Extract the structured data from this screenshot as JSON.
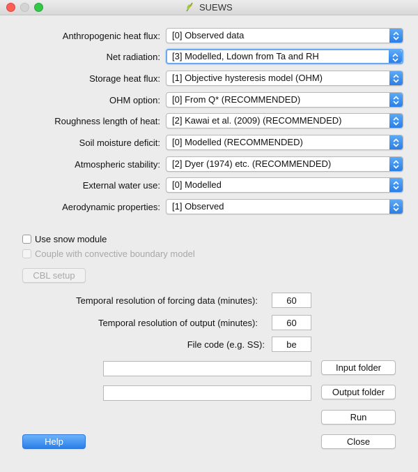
{
  "window": {
    "title": "SUEWS"
  },
  "options": [
    {
      "label": "Anthropogenic heat flux:",
      "value": "[0] Observed data"
    },
    {
      "label": "Net radiation:",
      "value": "[3] Modelled, Ldown from Ta and RH"
    },
    {
      "label": "Storage heat flux:",
      "value": "[1] Objective hysteresis model (OHM)"
    },
    {
      "label": "OHM option:",
      "value": "[0] From Q* (RECOMMENDED)"
    },
    {
      "label": "Roughness length of heat:",
      "value": "[2] Kawai et al. (2009) (RECOMMENDED)"
    },
    {
      "label": "Soil moisture deficit:",
      "value": "[0] Modelled (RECOMMENDED)"
    },
    {
      "label": "Atmospheric stability:",
      "value": "[2] Dyer (1974) etc. (RECOMMENDED)"
    },
    {
      "label": "External water use:",
      "value": "[0] Modelled"
    },
    {
      "label": "Aerodynamic properties:",
      "value": "[1] Observed"
    }
  ],
  "snow": {
    "label": "Use snow module",
    "checked": false
  },
  "cbl": {
    "label": "Couple with convective boundary model",
    "checked": false,
    "enabled": false
  },
  "cbl_setup_button": "CBL setup",
  "resolution_forcing": {
    "label": "Temporal resolution of forcing data (minutes):",
    "value": "60"
  },
  "resolution_output": {
    "label": "Temporal resolution of output (minutes):",
    "value": "60"
  },
  "file_code": {
    "label": "File code (e.g. SS):",
    "value": "be"
  },
  "input_folder": {
    "value": "",
    "button": "Input folder"
  },
  "output_folder": {
    "value": "",
    "button": "Output folder"
  },
  "run_button": "Run",
  "help_button": "Help",
  "close_button": "Close",
  "colors": {
    "accent": "#2a7ee8",
    "focus": "#6aa8f0",
    "close_light": "#fd5f57",
    "max_light": "#34c84a"
  },
  "icons": {
    "title": "leaf-icon",
    "stepper": "up-down-chevron-icon"
  }
}
